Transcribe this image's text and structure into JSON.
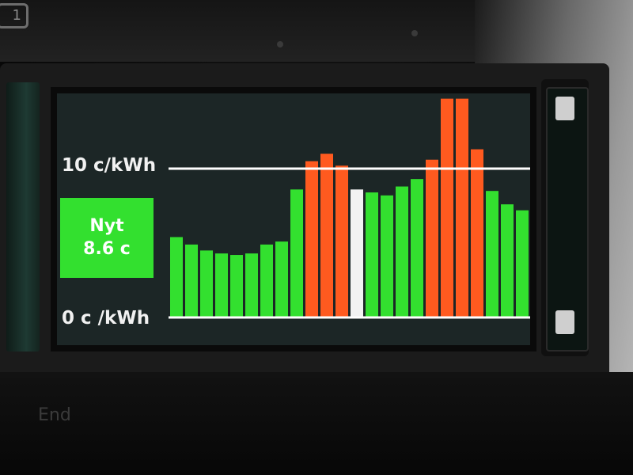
{
  "keyboard": {
    "key_label": "1",
    "bottom_key_label": "End"
  },
  "display": {
    "max_label": "10 c/kWh",
    "min_label": "0 c /kWh",
    "now_title": "Nyt",
    "now_value": "8.6 c"
  },
  "colors": {
    "normal": "#33e02f",
    "high": "#ff5a1f",
    "current": "#f2f2f2",
    "reference_line": "#ffffff",
    "screen_background": "#1c2626"
  },
  "chart_data": {
    "type": "bar",
    "title": "",
    "xlabel": "",
    "ylabel": "",
    "ylim": [
      0,
      10
    ],
    "reference_lines": [
      {
        "value": 10,
        "label": "10 c/kWh"
      },
      {
        "value": 0,
        "label": "0 c /kWh"
      }
    ],
    "values": [
      5.4,
      4.9,
      4.5,
      4.3,
      4.2,
      4.3,
      4.9,
      5.1,
      8.6,
      10.5,
      11.0,
      10.2,
      8.6,
      8.4,
      8.2,
      8.8,
      9.3,
      10.6,
      14.7,
      14.7,
      11.3,
      8.5,
      7.6,
      7.2
    ],
    "level": [
      "normal",
      "normal",
      "normal",
      "normal",
      "normal",
      "normal",
      "normal",
      "normal",
      "normal",
      "high",
      "high",
      "high",
      "current",
      "normal",
      "normal",
      "normal",
      "normal",
      "high",
      "high",
      "high",
      "high",
      "normal",
      "normal",
      "normal"
    ]
  }
}
